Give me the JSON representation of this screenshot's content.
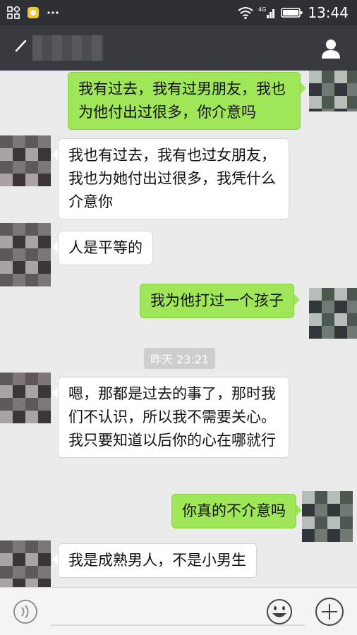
{
  "status_bar": {
    "time": "13:44",
    "network": "4G",
    "icons": [
      "app-grid-icon",
      "notification-app-icon",
      "more-icon",
      "wifi-icon",
      "signal-icon",
      "battery-icon"
    ]
  },
  "header": {
    "contact_name": "",
    "back_icon": "back-arrow-icon",
    "profile_icon": "person-icon"
  },
  "messages": [
    {
      "side": "out",
      "text": "我有过去，我有过男朋友，我也为他付出过很多，你介意吗"
    },
    {
      "side": "in",
      "text": "我也有过去，我有也过女朋友，我也为她付出过很多，我凭什么介意你"
    },
    {
      "side": "in",
      "text": "人是平等的"
    },
    {
      "side": "out",
      "text": "我为他打过一个孩子"
    },
    {
      "side": "in",
      "text": "嗯，那都是过去的事了，那时我们不认识，所以我不需要关心。我只要知道以后你的心在哪就行"
    },
    {
      "side": "out",
      "text": "你真的不介意吗"
    },
    {
      "side": "in",
      "text": "我是成熟男人，不是小男生"
    }
  ],
  "timestamp": "昨天 23:21",
  "input_bar": {
    "value": "",
    "icons": [
      "voice-icon",
      "emoji-icon",
      "plus-icon"
    ]
  },
  "colors": {
    "outgoing_bubble": "#9fe658",
    "incoming_bubble": "#ffffff",
    "header": "#393a3f",
    "background": "#ebebeb"
  }
}
